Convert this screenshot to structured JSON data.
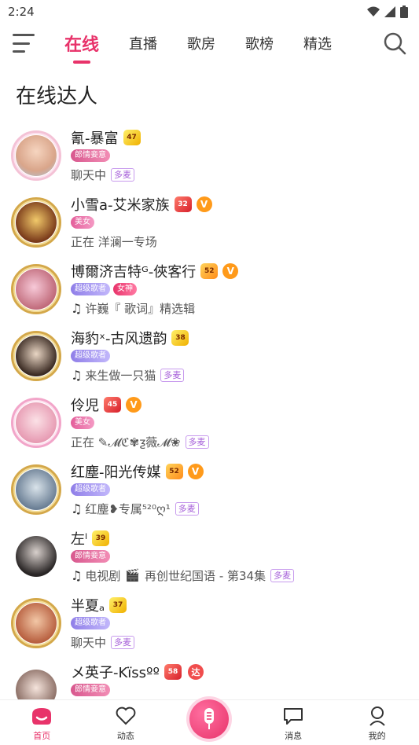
{
  "status_bar": {
    "time": "2:24"
  },
  "nav": {
    "tabs": [
      {
        "label": "在线",
        "active": true
      },
      {
        "label": "直播",
        "active": false
      },
      {
        "label": "歌房",
        "active": false
      },
      {
        "label": "歌榜",
        "active": false
      },
      {
        "label": "精选",
        "active": false
      }
    ]
  },
  "section_title": "在线达人",
  "users": [
    {
      "name": "氰-暴富",
      "level": "47",
      "badges": [
        "郎情妾意"
      ],
      "status": "聊天中",
      "multi": "多麦",
      "music": false
    },
    {
      "name": "小雪a-艾米家族",
      "level": "32",
      "vip": "V",
      "badges": [
        "美女"
      ],
      "status": "正在 洋澜一专场",
      "music": false
    },
    {
      "name": "博爾济吉特ᴳ-俠客行",
      "level": "52",
      "vip": "V",
      "badges": [
        "超级歌者",
        "女神"
      ],
      "status": "许巍『 歌词』精选辑",
      "music": true
    },
    {
      "name": "海豹ˣ-古风遗韵",
      "level": "38",
      "badges": [
        "超级歌者"
      ],
      "status": "来生做一只猫",
      "multi": "多麦",
      "music": true
    },
    {
      "name": "伶児",
      "level": "45",
      "vip": "V",
      "badges": [
        "美女"
      ],
      "status": "正在 ✎𝓜ℭ✾ƺ薇𝓜❀",
      "multi": "多麦",
      "music": false
    },
    {
      "name": "红塵-阳光传媒",
      "level": "52",
      "vip": "V",
      "badges": [
        "超级歌者"
      ],
      "status": "红塵❥专属⁵²⁰ღ¹",
      "multi": "多麦",
      "music": true
    },
    {
      "name": "左ˡ",
      "level": "39",
      "badges": [
        "郎情妾意"
      ],
      "status": "电视剧",
      "status_extra": "再创世纪国语 - 第34集",
      "multi": "多麦",
      "music": true
    },
    {
      "name": "半夏ₐ",
      "level": "37",
      "badges": [
        "超级歌者"
      ],
      "status": "聊天中",
      "multi": "多麦",
      "music": false
    },
    {
      "name": "メ英子-Kïssºº",
      "level": "58",
      "da": "达",
      "badges": [
        "郎情妾意"
      ],
      "status": "",
      "music": false
    }
  ],
  "bottom_nav": [
    {
      "label": "首页",
      "active": true
    },
    {
      "label": "动态",
      "active": false
    },
    {
      "label": "",
      "active": false
    },
    {
      "label": "消息",
      "active": false
    },
    {
      "label": "我的",
      "active": false
    }
  ],
  "colors": {
    "accent": "#e8336a",
    "vip": "#ff9a1a",
    "multi": "#a660d9"
  }
}
